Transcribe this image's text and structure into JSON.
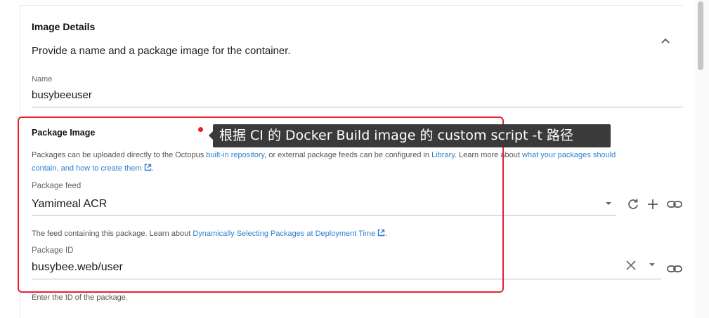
{
  "section": {
    "title": "Image Details",
    "description": "Provide a name and a package image for the container."
  },
  "name_field": {
    "label": "Name",
    "value": "busybeeuser"
  },
  "package_image": {
    "title": "Package Image",
    "intro_part1": "Packages can be uploaded directly to the Octopus ",
    "intro_link1": "built-in repository",
    "intro_part2": ", or external package feeds can be configured in ",
    "intro_link2": "Library",
    "intro_part3": ". Learn more about ",
    "intro_link3a": "what your packages should",
    "intro_link3b": "contain, and how to create them"
  },
  "package_feed": {
    "label": "Package feed",
    "value": "Yamimeal ACR",
    "helper_text": "The feed containing this package. Learn about ",
    "helper_link": "Dynamically Selecting Packages at Deployment Time"
  },
  "package_id": {
    "label": "Package ID",
    "value": "busybee.web/user",
    "helper_text": "Enter the ID of the package."
  },
  "annotation": {
    "tooltip": "根据 CI 的 Docker Build image 的 custom script -t 路径",
    "highlight_color": "#e8202f"
  },
  "icons": {
    "collapse": "chevron-up-icon",
    "dropdown": "caret-down-icon",
    "refresh": "refresh-icon",
    "add": "plus-icon",
    "link": "link-icon",
    "clear": "close-icon",
    "external": "external-link-icon"
  },
  "colors": {
    "link": "#2f7fd0",
    "tooltip_bg": "#3a3a3a"
  }
}
